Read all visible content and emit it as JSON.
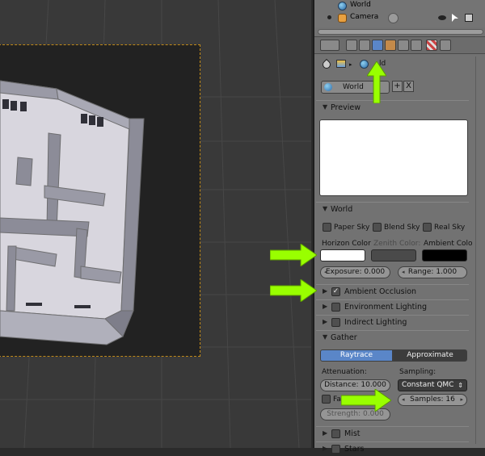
{
  "outliner": {
    "items": [
      {
        "label": "World",
        "icon": "world-icon"
      },
      {
        "label": "Camera",
        "icon": "camera-icon"
      }
    ]
  },
  "context": {
    "path_label": "ld"
  },
  "world_datablock": {
    "name": "World",
    "add_label": "+",
    "remove_label": "X"
  },
  "sections": {
    "preview": {
      "label": "Preview"
    },
    "world": {
      "label": "World",
      "paper_sky": "Paper Sky",
      "blend_sky": "Blend Sky",
      "real_sky": "Real Sky",
      "horizon_color_label": "Horizon Color",
      "zenith_color_label": "Zenith Color:",
      "ambient_color_label": "Ambient Colo",
      "horizon_color": "#ffffff",
      "zenith_color": "#4a4a4a",
      "ambient_color": "#000000",
      "exposure": "Exposure: 0.000",
      "range": "Range: 1.000"
    },
    "ambient_occlusion": {
      "label": "Ambient Occlusion",
      "checked": true,
      "check_glyph": "✓"
    },
    "environment_lighting": {
      "label": "Environment Lighting"
    },
    "indirect_lighting": {
      "label": "Indirect Lighting"
    },
    "gather": {
      "label": "Gather",
      "raytrace": "Raytrace",
      "approximate": "Approximate",
      "attenuation_label": "Attenuation:",
      "sampling_label": "Sampling:",
      "distance": "Distance: 10.000",
      "sampling_value": "Constant QMC",
      "falloff_label": "Fal",
      "samples": "Samples: 16",
      "strength": "Strength: 0.000"
    },
    "mist": {
      "label": "Mist"
    },
    "stars": {
      "label": "Stars"
    }
  },
  "colors": {
    "accent_blue": "#5a86c8",
    "arrow_green": "#99ff00",
    "render_border": "#c08a1a"
  }
}
